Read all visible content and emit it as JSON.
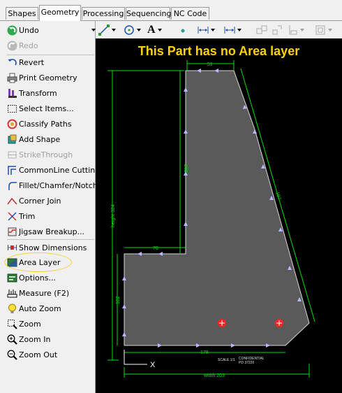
{
  "tabs": [
    "Shapes",
    "Geometry",
    "Processing",
    "Sequencing",
    "NC Code"
  ],
  "active_tab": "Geometry",
  "sidebar": {
    "undo": "Undo",
    "redo": "Redo",
    "items": [
      {
        "label": "Revert",
        "icon": "revert-icon"
      },
      {
        "label": "Print Geometry",
        "icon": "printer-icon"
      },
      {
        "label": "Transform",
        "icon": "transform-icon"
      },
      {
        "label": "Select Items...",
        "icon": "select-box-icon"
      },
      {
        "label": "Classify Paths",
        "icon": "classify-paths-icon"
      },
      {
        "label": "Add Shape",
        "icon": "add-shape-icon"
      },
      {
        "label": "StrikeThrough",
        "icon": "strikethrough-icon",
        "disabled": true
      },
      {
        "label": "CommonLine Cutting",
        "icon": "commonline-icon"
      },
      {
        "label": "Fillet/Chamfer/Notch",
        "icon": "fillet-icon"
      },
      {
        "label": "Corner Join",
        "icon": "corner-join-icon"
      },
      {
        "label": "Trim",
        "icon": "trim-icon"
      },
      {
        "label": "Jigsaw Breakup...",
        "icon": "jigsaw-icon"
      },
      {
        "label": "Show Dimensions",
        "icon": "dimensions-icon"
      },
      {
        "label": "Area Layer",
        "icon": "area-layer-icon"
      },
      {
        "label": "Options...",
        "icon": "options-icon"
      },
      {
        "label": "Measure (F2)",
        "icon": "measure-icon"
      },
      {
        "label": "Auto Zoom",
        "icon": "auto-zoom-icon"
      },
      {
        "label": "Zoom",
        "icon": "zoom-box-icon"
      },
      {
        "label": "Zoom In",
        "icon": "zoom-in-icon"
      },
      {
        "label": "Zoom Out",
        "icon": "zoom-out-icon"
      }
    ]
  },
  "canvas": {
    "message": "This Part has no Area layer",
    "dims": {
      "top": "51",
      "left_upper": "203",
      "diagonal": "197",
      "height": "height 324",
      "notch": "70",
      "left_lower": "102",
      "bottom": "178",
      "width": "width 203",
      "axis": "X",
      "scale": "SCALE 1/1",
      "conf1": "CONFIDENTIAL",
      "conf2": "PD 37220"
    }
  },
  "colors": {
    "canvas_bg": "#000000",
    "part_fill": "#5a5a5a",
    "dimension": "#00e000",
    "message": "#ffd200",
    "highlight": "#f2d23a",
    "marker": "#ff2020",
    "vertex": "#b8b8ff"
  }
}
